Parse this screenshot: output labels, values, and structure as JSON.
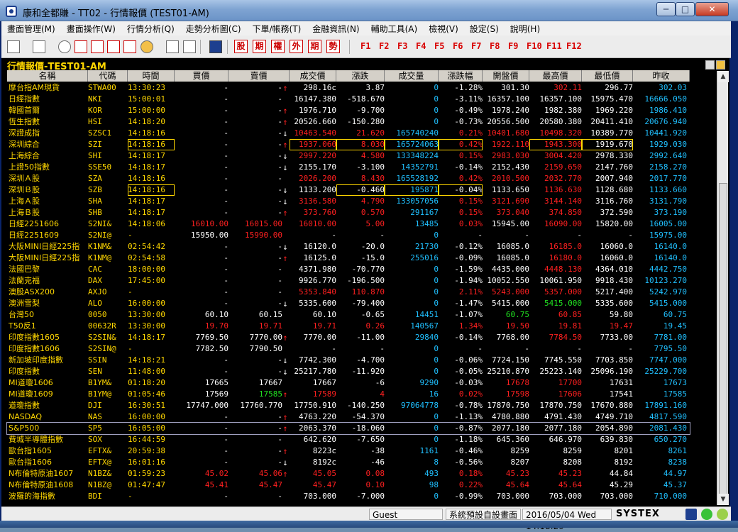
{
  "window": {
    "title": "康和全都賺 - TT02 - 行情報價 (TEST01-AM)",
    "min": "─",
    "max": "□",
    "close": "✕"
  },
  "menu": [
    "畫面管理(M)",
    "畫面操作(W)",
    "行情分析(Q)",
    "走勢分析圖(C)",
    "下單/帳務(T)",
    "金融資訊(N)",
    "輔助工具(A)",
    "檢視(V)",
    "設定(S)",
    "說明(H)"
  ],
  "toolbar": {
    "red_buttons": [
      "股",
      "期",
      "權",
      "外",
      "期",
      "勢"
    ],
    "fkeys": [
      "F1",
      "F2",
      "F3",
      "F4",
      "F5",
      "F6",
      "F7",
      "F8",
      "F9",
      "F10",
      "F11",
      "F12"
    ]
  },
  "panel": {
    "title": "行情報價-TEST01-AM"
  },
  "columns": [
    "名稱",
    "代碼",
    "時間",
    "買價",
    "賣價",
    "成交價",
    "漲跌",
    "成交量",
    "漲跌幅",
    "開盤價",
    "最高價",
    "最低價",
    "昨收"
  ],
  "rows": [
    {
      "name": "摩台指AM現貨",
      "code": "STWA00",
      "time": "13:30:23",
      "bid": "-",
      "ask": "-",
      "arrow": "↑",
      "last": "298.16c",
      "chg": "3.87",
      "vol": "0",
      "pct": "-1.28%",
      "open": "301.30",
      "high": "302.11",
      "low": "296.77",
      "prev": "302.03",
      "cc": {
        "last": "W",
        "chg": "W",
        "pct": "W",
        "open": "W",
        "high": "R",
        "low": "W",
        "arrow": "R"
      }
    },
    {
      "name": "日經指數",
      "code": "NKI",
      "time": "15:00:01",
      "bid": "-",
      "ask": "-",
      "arrow": "",
      "last": "16147.380",
      "chg": "-518.670",
      "vol": "0",
      "pct": "-3.11%",
      "open": "16357.100",
      "high": "16357.100",
      "low": "15975.470",
      "prev": "16666.050",
      "cc": {
        "last": "W",
        "chg": "W",
        "pct": "W",
        "open": "W",
        "high": "W",
        "low": "W"
      }
    },
    {
      "name": "韓國首爾",
      "code": "KOR",
      "time": "15:00:00",
      "bid": "-",
      "ask": "-",
      "arrow": "↑",
      "last": "1976.710",
      "chg": "-9.700",
      "vol": "0",
      "pct": "-0.49%",
      "open": "1978.240",
      "high": "1982.380",
      "low": "1969.220",
      "prev": "1986.410",
      "cc": {
        "last": "W",
        "chg": "W",
        "pct": "W",
        "open": "W",
        "high": "W",
        "low": "W",
        "arrow": "R"
      }
    },
    {
      "name": "恆生指數",
      "code": "HSI",
      "time": "14:18:20",
      "bid": "-",
      "ask": "-",
      "arrow": "↑",
      "last": "20526.660",
      "chg": "-150.280",
      "vol": "0",
      "pct": "-0.73%",
      "open": "20556.500",
      "high": "20580.380",
      "low": "20411.410",
      "prev": "20676.940",
      "cc": {
        "last": "W",
        "chg": "W",
        "pct": "W",
        "open": "W",
        "high": "W",
        "low": "W",
        "arrow": "R"
      }
    },
    {
      "name": "深證成指",
      "code": "SZSC1",
      "time": "14:18:16",
      "bid": "-",
      "ask": "-",
      "arrow": "↓",
      "last": "10463.540",
      "chg": "21.620",
      "vol": "165740240",
      "pct": "0.21%",
      "open": "10401.680",
      "high": "10498.320",
      "low": "10389.770",
      "prev": "10441.920",
      "cc": {
        "last": "R",
        "chg": "R",
        "pct": "R",
        "open": "R",
        "high": "R",
        "low": "W",
        "arrow": "W"
      }
    },
    {
      "name": "深圳綜合",
      "code": "SZI",
      "time": "14:18:16",
      "bid": "-",
      "ask": "-",
      "arrow": "↑",
      "last": "1937.060",
      "chg": "8.030",
      "vol": "165724063",
      "pct": "0.42%",
      "open": "1922.110",
      "high": "1943.300",
      "low": "1919.670",
      "prev": "1929.030",
      "cc": {
        "last": "R",
        "chg": "R",
        "pct": "R",
        "open": "R",
        "high": "R",
        "low": "W",
        "arrow": "R"
      },
      "boxed": [
        "time",
        "last",
        "chg",
        "vol",
        "pct",
        "high",
        "low"
      ]
    },
    {
      "name": "上海綜合",
      "code": "SHI",
      "time": "14:18:17",
      "bid": "-",
      "ask": "-",
      "arrow": "↓",
      "last": "2997.220",
      "chg": "4.580",
      "vol": "133348224",
      "pct": "0.15%",
      "open": "2983.030",
      "high": "3004.420",
      "low": "2978.330",
      "prev": "2992.640",
      "cc": {
        "last": "R",
        "chg": "R",
        "pct": "R",
        "open": "R",
        "high": "R",
        "low": "W",
        "arrow": "W"
      }
    },
    {
      "name": "上證50指數",
      "code": "SSE50",
      "time": "14:18:17",
      "bid": "-",
      "ask": "-",
      "arrow": "↓",
      "last": "2155.170",
      "chg": "-3.100",
      "vol": "14352791",
      "pct": "-0.14%",
      "open": "2152.430",
      "high": "2159.650",
      "low": "2147.760",
      "prev": "2158.270",
      "cc": {
        "last": "W",
        "chg": "W",
        "pct": "W",
        "open": "W",
        "high": "R",
        "low": "W",
        "arrow": "W"
      }
    },
    {
      "name": "深圳Ａ股",
      "code": "SZA",
      "time": "14:18:16",
      "bid": "-",
      "ask": "-",
      "arrow": "",
      "last": "2026.200",
      "chg": "8.430",
      "vol": "165528192",
      "pct": "0.42%",
      "open": "2010.500",
      "high": "2032.770",
      "low": "2007.940",
      "prev": "2017.770",
      "cc": {
        "last": "R",
        "chg": "R",
        "pct": "R",
        "open": "R",
        "high": "R",
        "low": "W"
      }
    },
    {
      "name": "深圳Ｂ股",
      "code": "SZB",
      "time": "14:18:16",
      "bid": "-",
      "ask": "-",
      "arrow": "↓",
      "last": "1133.200",
      "chg": "-0.460",
      "vol": "195871",
      "pct": "-0.04%",
      "open": "1133.650",
      "high": "1136.630",
      "low": "1128.680",
      "prev": "1133.660",
      "cc": {
        "last": "W",
        "chg": "W",
        "pct": "W",
        "open": "W",
        "high": "R",
        "low": "W",
        "arrow": "W"
      },
      "boxed": [
        "time",
        "chg",
        "vol",
        "pct"
      ]
    },
    {
      "name": "上海Ａ股",
      "code": "SHA",
      "time": "14:18:17",
      "bid": "-",
      "ask": "-",
      "arrow": "↓",
      "last": "3136.580",
      "chg": "4.790",
      "vol": "133057056",
      "pct": "0.15%",
      "open": "3121.690",
      "high": "3144.140",
      "low": "3116.760",
      "prev": "3131.790",
      "cc": {
        "last": "R",
        "chg": "R",
        "pct": "R",
        "open": "R",
        "high": "R",
        "low": "W",
        "arrow": "W"
      }
    },
    {
      "name": "上海Ｂ股",
      "code": "SHB",
      "time": "14:18:17",
      "bid": "-",
      "ask": "-",
      "arrow": "↑",
      "last": "373.760",
      "chg": "0.570",
      "vol": "291167",
      "pct": "0.15%",
      "open": "373.040",
      "high": "374.850",
      "low": "372.590",
      "prev": "373.190",
      "cc": {
        "last": "R",
        "chg": "R",
        "pct": "R",
        "open": "R",
        "high": "R",
        "low": "W",
        "arrow": "R"
      }
    },
    {
      "name": "日經2251606",
      "code": "S2NI&",
      "time": "14:18:06",
      "bid": "16010.00",
      "ask": "16015.00",
      "arrow": "",
      "last": "16010.00",
      "chg": "5.00",
      "vol": "13485",
      "pct": "0.03%",
      "open": "15945.00",
      "high": "16090.00",
      "low": "15820.00",
      "prev": "16005.00",
      "cc": {
        "bid": "R",
        "ask": "R",
        "last": "R",
        "chg": "R",
        "pct": "R",
        "open": "W",
        "high": "R",
        "low": "W"
      }
    },
    {
      "name": "日經2251609",
      "code": "S2NI@",
      "time": "-",
      "bid": "15950.00",
      "ask": "15990.00",
      "arrow": "",
      "last": "-",
      "chg": "-",
      "vol": "0",
      "pct": "-",
      "open": "-",
      "high": "-",
      "low": "-",
      "prev": "15975.00",
      "cc": {
        "bid": "W",
        "ask": "R",
        "last": "W",
        "chg": "W",
        "pct": "W",
        "open": "W",
        "high": "W",
        "low": "W"
      }
    },
    {
      "name": "大阪MINI日經225指",
      "code": "K1NM&",
      "time": "02:54:42",
      "bid": "-",
      "ask": "-",
      "arrow": "↓",
      "last": "16120.0",
      "chg": "-20.0",
      "vol": "21730",
      "pct": "-0.12%",
      "open": "16085.0",
      "high": "16185.0",
      "low": "16060.0",
      "prev": "16140.0",
      "cc": {
        "last": "W",
        "chg": "W",
        "pct": "W",
        "open": "W",
        "high": "R",
        "low": "W",
        "arrow": "W"
      }
    },
    {
      "name": "大阪MINI日經225指",
      "code": "K1NM@",
      "time": "02:54:58",
      "bid": "-",
      "ask": "-",
      "arrow": "↑",
      "last": "16125.0",
      "chg": "-15.0",
      "vol": "255016",
      "pct": "-0.09%",
      "open": "16085.0",
      "high": "16180.0",
      "low": "16060.0",
      "prev": "16140.0",
      "cc": {
        "last": "W",
        "chg": "W",
        "pct": "W",
        "open": "W",
        "high": "R",
        "low": "W",
        "arrow": "R"
      }
    },
    {
      "name": "法國巴黎",
      "code": "CAC",
      "time": "18:00:00",
      "bid": "-",
      "ask": "-",
      "arrow": "",
      "last": "4371.980",
      "chg": "-70.770",
      "vol": "0",
      "pct": "-1.59%",
      "open": "4435.000",
      "high": "4448.130",
      "low": "4364.010",
      "prev": "4442.750",
      "cc": {
        "last": "W",
        "chg": "W",
        "pct": "W",
        "open": "W",
        "high": "R",
        "low": "W"
      }
    },
    {
      "name": "法蘭克福",
      "code": "DAX",
      "time": "17:45:00",
      "bid": "-",
      "ask": "-",
      "arrow": "",
      "last": "9926.770",
      "chg": "-196.500",
      "vol": "0",
      "pct": "-1.94%",
      "open": "10052.550",
      "high": "10061.950",
      "low": "9918.430",
      "prev": "10123.270",
      "cc": {
        "last": "W",
        "chg": "W",
        "pct": "W",
        "open": "W",
        "high": "W",
        "low": "W"
      }
    },
    {
      "name": "澳股ASX200",
      "code": "AXJO",
      "time": "-",
      "bid": "-",
      "ask": "-",
      "arrow": "",
      "last": "5353.840",
      "chg": "110.870",
      "vol": "0",
      "pct": "2.11%",
      "open": "5243.000",
      "high": "5357.000",
      "low": "5217.400",
      "prev": "5242.970",
      "cc": {
        "last": "R",
        "chg": "R",
        "pct": "R",
        "open": "R",
        "high": "R",
        "low": "W"
      }
    },
    {
      "name": "澳洲雪梨",
      "code": "ALO",
      "time": "16:00:00",
      "bid": "-",
      "ask": "-",
      "arrow": "↓",
      "last": "5335.600",
      "chg": "-79.400",
      "vol": "0",
      "pct": "-1.47%",
      "open": "5415.000",
      "high": "5415.000",
      "low": "5335.600",
      "prev": "5415.000",
      "cc": {
        "last": "W",
        "chg": "W",
        "pct": "W",
        "open": "W",
        "high": "G",
        "low": "W",
        "arrow": "W"
      }
    },
    {
      "name": "台灣50",
      "code": "0050",
      "time": "13:30:00",
      "bid": "60.10",
      "ask": "60.15",
      "arrow": "",
      "last": "60.10",
      "chg": "-0.65",
      "vol": "14451",
      "pct": "-1.07%",
      "open": "60.75",
      "high": "60.85",
      "low": "59.80",
      "prev": "60.75",
      "cc": {
        "bid": "W",
        "ask": "W",
        "last": "W",
        "chg": "W",
        "pct": "W",
        "open": "G",
        "high": "R",
        "low": "W"
      }
    },
    {
      "name": "T50反1",
      "code": "00632R",
      "time": "13:30:00",
      "bid": "19.70",
      "ask": "19.71",
      "arrow": "",
      "last": "19.71",
      "chg": "0.26",
      "vol": "140567",
      "pct": "1.34%",
      "open": "19.50",
      "high": "19.81",
      "low": "19.47",
      "prev": "19.45",
      "cc": {
        "bid": "R",
        "ask": "R",
        "last": "R",
        "chg": "R",
        "pct": "R",
        "open": "R",
        "high": "R",
        "low": "R"
      }
    },
    {
      "name": "印度指數1605",
      "code": "S2SIN&",
      "time": "14:18:17",
      "bid": "7769.50",
      "ask": "7770.00",
      "arrow": "↑",
      "last": "7770.00",
      "chg": "-11.00",
      "vol": "29840",
      "pct": "-0.14%",
      "open": "7768.00",
      "high": "7784.50",
      "low": "7733.00",
      "prev": "7781.00",
      "cc": {
        "bid": "W",
        "ask": "W",
        "last": "W",
        "chg": "W",
        "pct": "W",
        "open": "W",
        "high": "R",
        "low": "W",
        "arrow": "R"
      }
    },
    {
      "name": "印度指數1606",
      "code": "S2SIN@",
      "time": "-",
      "bid": "7782.50",
      "ask": "7790.50",
      "arrow": "",
      "last": "-",
      "chg": "-",
      "vol": "0",
      "pct": "-",
      "open": "-",
      "high": "-",
      "low": "-",
      "prev": "7795.50",
      "cc": {
        "bid": "W",
        "ask": "W",
        "last": "W",
        "chg": "W",
        "pct": "W",
        "open": "W",
        "high": "W",
        "low": "W"
      }
    },
    {
      "name": "新加坡印度指數",
      "code": "SSIN",
      "time": "14:18:21",
      "bid": "-",
      "ask": "-",
      "arrow": "↓",
      "last": "7742.300",
      "chg": "-4.700",
      "vol": "0",
      "pct": "-0.06%",
      "open": "7724.150",
      "high": "7745.550",
      "low": "7703.850",
      "prev": "7747.000",
      "cc": {
        "last": "W",
        "chg": "W",
        "pct": "W",
        "open": "W",
        "high": "W",
        "low": "W",
        "arrow": "W"
      }
    },
    {
      "name": "印度指數",
      "code": "SEN",
      "time": "11:48:00",
      "bid": "-",
      "ask": "-",
      "arrow": "↓",
      "last": "25217.780",
      "chg": "-11.920",
      "vol": "0",
      "pct": "-0.05%",
      "open": "25210.870",
      "high": "25223.140",
      "low": "25096.190",
      "prev": "25229.700",
      "cc": {
        "last": "W",
        "chg": "W",
        "pct": "W",
        "open": "W",
        "high": "W",
        "low": "W",
        "arrow": "W"
      }
    },
    {
      "name": "MI道瓊1606",
      "code": "B1YM&",
      "time": "01:18:20",
      "bid": "17665",
      "ask": "17667",
      "arrow": "",
      "last": "17667",
      "chg": "-6",
      "vol": "9290",
      "pct": "-0.03%",
      "open": "17678",
      "high": "17700",
      "low": "17631",
      "prev": "17673",
      "cc": {
        "bid": "W",
        "ask": "W",
        "last": "W",
        "chg": "W",
        "pct": "W",
        "open": "R",
        "high": "R",
        "low": "W"
      }
    },
    {
      "name": "MI道瓊1609",
      "code": "B1YM@",
      "time": "01:05:46",
      "bid": "17569",
      "ask": "17585",
      "arrow": "↑",
      "last": "17589",
      "chg": "4",
      "vol": "16",
      "pct": "0.02%",
      "open": "17598",
      "high": "17606",
      "low": "17541",
      "prev": "17585",
      "cc": {
        "bid": "W",
        "ask": "G",
        "last": "R",
        "chg": "R",
        "pct": "R",
        "open": "R",
        "high": "R",
        "low": "W",
        "arrow": "R"
      }
    },
    {
      "name": "道瓊指數",
      "code": "DJI",
      "time": "16:30:51",
      "bid": "17747.000",
      "ask": "17760.770",
      "arrow": "",
      "last": "17750.910",
      "chg": "-140.250",
      "vol": "97064778",
      "pct": "-0.78%",
      "open": "17870.750",
      "high": "17870.750",
      "low": "17670.880",
      "prev": "17891.160",
      "cc": {
        "bid": "W",
        "ask": "W",
        "last": "W",
        "chg": "W",
        "pct": "W",
        "open": "W",
        "high": "W",
        "low": "W"
      }
    },
    {
      "name": "NASDAQ",
      "code": "NAS",
      "time": "16:00:00",
      "bid": "-",
      "ask": "-",
      "arrow": "↑",
      "last": "4763.220",
      "chg": "-54.370",
      "vol": "0",
      "pct": "-1.13%",
      "open": "4780.880",
      "high": "4791.430",
      "low": "4749.710",
      "prev": "4817.590",
      "cc": {
        "last": "W",
        "chg": "W",
        "pct": "W",
        "open": "W",
        "high": "W",
        "low": "W",
        "arrow": "R"
      }
    },
    {
      "name": "S&P500",
      "code": "SP5",
      "time": "16:05:00",
      "bid": "-",
      "ask": "-",
      "arrow": "↑",
      "last": "2063.370",
      "chg": "-18.060",
      "vol": "0",
      "pct": "-0.87%",
      "open": "2077.180",
      "high": "2077.180",
      "low": "2054.890",
      "prev": "2081.430",
      "cc": {
        "last": "W",
        "chg": "W",
        "pct": "W",
        "open": "W",
        "high": "W",
        "low": "W",
        "arrow": "R"
      },
      "selected": true
    },
    {
      "name": "費城半導體指數",
      "code": "SOX",
      "time": "16:44:59",
      "bid": "-",
      "ask": "-",
      "arrow": "",
      "last": "642.620",
      "chg": "-7.650",
      "vol": "0",
      "pct": "-1.18%",
      "open": "645.360",
      "high": "646.970",
      "low": "639.830",
      "prev": "650.270",
      "cc": {
        "last": "W",
        "chg": "W",
        "pct": "W",
        "open": "W",
        "high": "W",
        "low": "W"
      }
    },
    {
      "name": "歐台指1605",
      "code": "EFTX&",
      "time": "20:59:38",
      "bid": "-",
      "ask": "-",
      "arrow": "↑",
      "last": "8223c",
      "chg": "-38",
      "vol": "1161",
      "pct": "-0.46%",
      "open": "8259",
      "high": "8259",
      "low": "8201",
      "prev": "8261",
      "cc": {
        "last": "W",
        "chg": "W",
        "pct": "W",
        "open": "W",
        "high": "W",
        "low": "W",
        "arrow": "R"
      }
    },
    {
      "name": "歐台指1606",
      "code": "EFTX@",
      "time": "16:01:16",
      "bid": "-",
      "ask": "-",
      "arrow": "↓",
      "last": "8192c",
      "chg": "-46",
      "vol": "8",
      "pct": "-0.56%",
      "open": "8207",
      "high": "8208",
      "low": "8192",
      "prev": "8238",
      "cc": {
        "last": "W",
        "chg": "W",
        "pct": "W",
        "open": "W",
        "high": "W",
        "low": "W",
        "arrow": "W"
      }
    },
    {
      "name": "N布倫特原油1607",
      "code": "N1BZ&",
      "time": "01:59:23",
      "bid": "45.02",
      "ask": "45.06",
      "arrow": "↑",
      "last": "45.05",
      "chg": "0.08",
      "vol": "493",
      "pct": "0.18%",
      "open": "45.23",
      "high": "45.23",
      "low": "44.84",
      "prev": "44.97",
      "cc": {
        "bid": "R",
        "ask": "R",
        "last": "R",
        "chg": "R",
        "pct": "R",
        "open": "R",
        "high": "R",
        "low": "W",
        "arrow": "R"
      }
    },
    {
      "name": "N布倫特原油1608",
      "code": "N1BZ@",
      "time": "01:47:47",
      "bid": "45.41",
      "ask": "45.47",
      "arrow": "",
      "last": "45.47",
      "chg": "0.10",
      "vol": "98",
      "pct": "0.22%",
      "open": "45.64",
      "high": "45.64",
      "low": "45.29",
      "prev": "45.37",
      "cc": {
        "bid": "R",
        "ask": "R",
        "last": "R",
        "chg": "R",
        "pct": "R",
        "open": "R",
        "high": "R",
        "low": "W"
      }
    },
    {
      "name": "波羅的海指數",
      "code": "BDI",
      "time": "-",
      "bid": "-",
      "ask": "-",
      "arrow": "",
      "last": "703.000",
      "chg": "-7.000",
      "vol": "0",
      "pct": "-0.99%",
      "open": "703.000",
      "high": "703.000",
      "low": "703.000",
      "prev": "710.000",
      "cc": {
        "last": "W",
        "chg": "W",
        "pct": "W",
        "open": "W",
        "high": "W",
        "low": "W"
      }
    }
  ],
  "status": {
    "user": "Guest",
    "layout": "系統預設自設畫面",
    "datetime": "2016/05/04 Wed 14:18:29",
    "brand": "SYSTEX"
  }
}
